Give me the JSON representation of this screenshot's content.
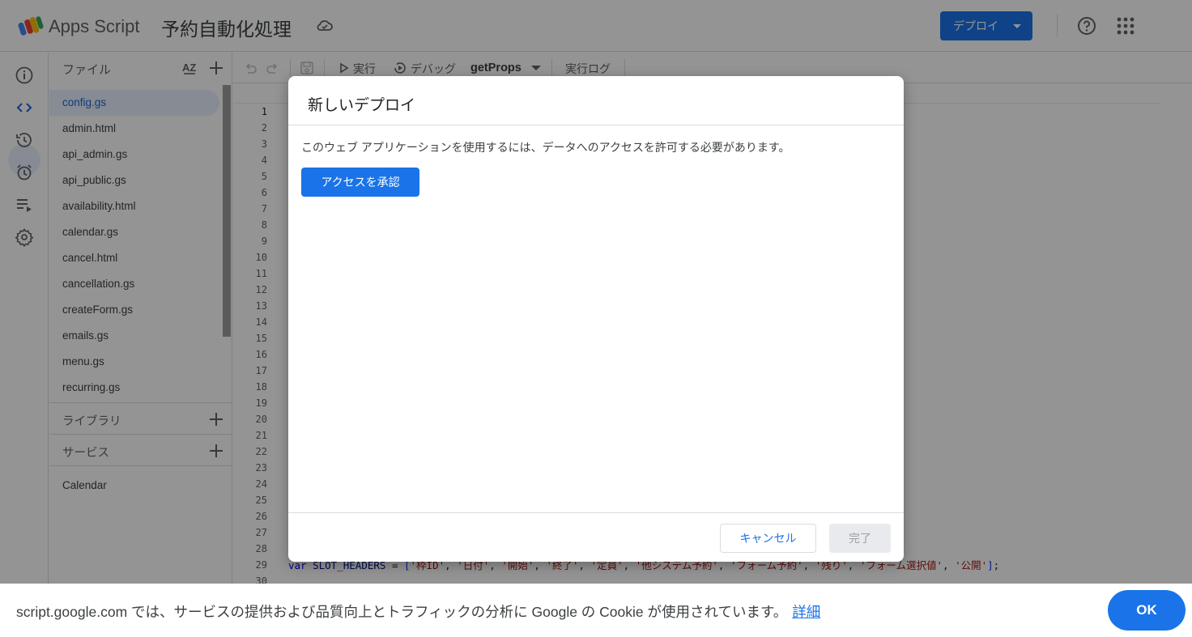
{
  "header": {
    "app_name": "Apps Script",
    "project_title": "予約自動化処理",
    "deploy_label": "デプロイ",
    "icons": [
      "apps-script-logo",
      "cloud-icon",
      "help-icon",
      "apps-grid-icon"
    ]
  },
  "rail": {
    "icons": [
      "info-icon",
      "code-icon",
      "history-icon",
      "alarm-icon",
      "executions-icon",
      "settings-icon"
    ],
    "active": "code-icon"
  },
  "files_panel": {
    "title": "ファイル",
    "files": [
      {
        "name": "config.gs",
        "active": true
      },
      {
        "name": "admin.html"
      },
      {
        "name": "api_admin.gs"
      },
      {
        "name": "api_public.gs"
      },
      {
        "name": "availability.html"
      },
      {
        "name": "calendar.gs"
      },
      {
        "name": "cancel.html"
      },
      {
        "name": "cancellation.gs"
      },
      {
        "name": "createForm.gs"
      },
      {
        "name": "emails.gs"
      },
      {
        "name": "menu.gs"
      },
      {
        "name": "recurring.gs"
      }
    ],
    "libraries_label": "ライブラリ",
    "services_label": "サービス",
    "services": [
      "Calendar"
    ]
  },
  "toolbar": {
    "run_label": "実行",
    "debug_label": "デバッグ",
    "function_name": "getProps",
    "log_label": "実行ログ"
  },
  "editor": {
    "line_count": 30,
    "current_line": 1,
    "code_line_29": {
      "keyword": "var",
      "name": "SLOT_HEADERS",
      "operator": " = ",
      "values": [
        "枠ID",
        "日付",
        "開始",
        "終了",
        "定員",
        "他システム予約",
        "フォーム予約",
        "残り",
        "フォーム選択値",
        "公開"
      ]
    }
  },
  "dialog": {
    "title": "新しいデプロイ",
    "message": "このウェブ アプリケーションを使用するには、データへのアクセスを許可する必要があります。",
    "authorize_label": "アクセスを承認",
    "cancel_label": "キャンセル",
    "done_label": "完了"
  },
  "cookie_bar": {
    "text": "script.google.com では、サービスの提供および品質向上とトラフィックの分析に Google の Cookie が使用されています。",
    "link_label": "詳細",
    "ok_label": "OK"
  },
  "colors": {
    "accent": "#1a73e8",
    "active_bg": "#e8f0fe",
    "border": "#dadce0",
    "scrim": "rgba(0,0,0,0.42)"
  }
}
